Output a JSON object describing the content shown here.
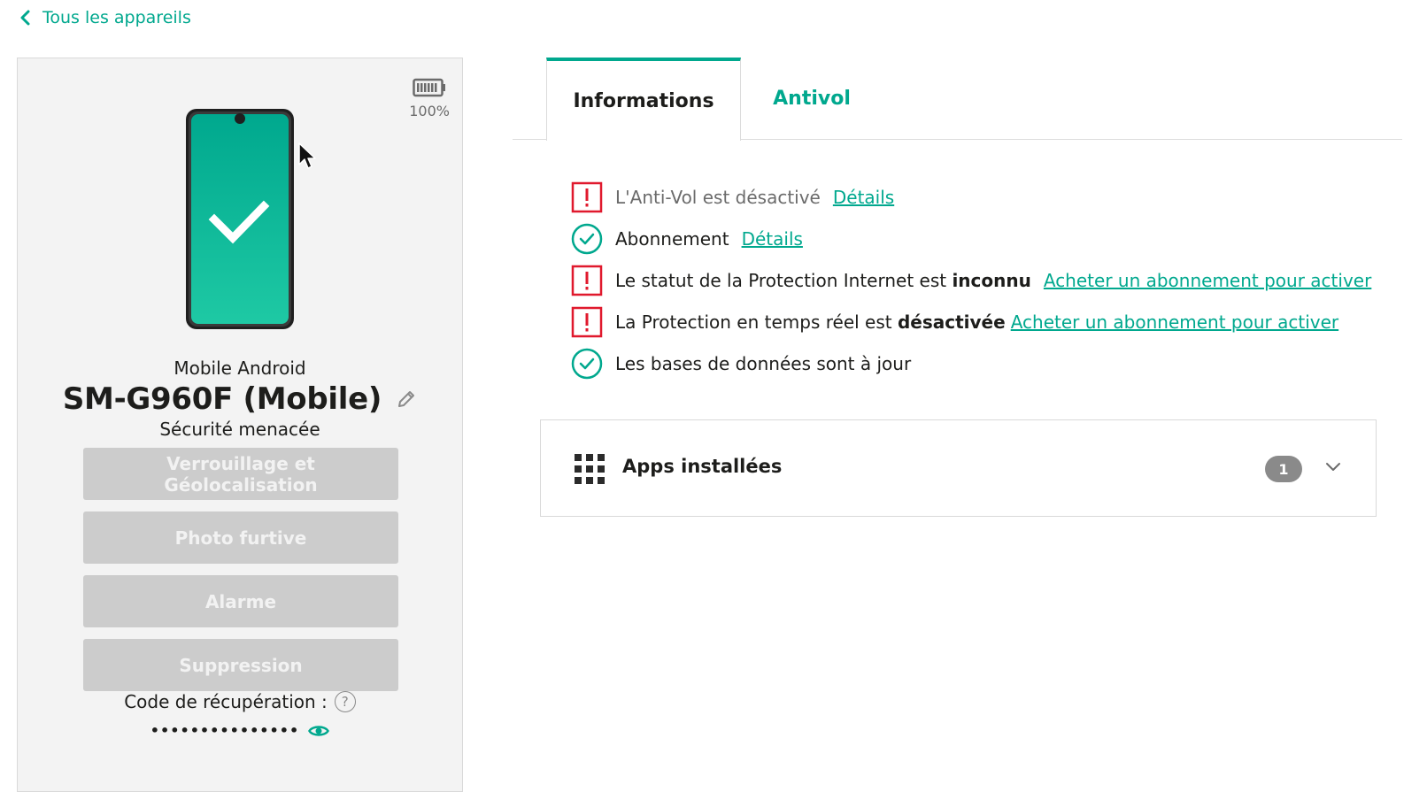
{
  "back_link": {
    "label": "Tous les appareils"
  },
  "device": {
    "battery_level": "100%",
    "type": "Mobile Android",
    "name": "SM-G960F (Mobile)",
    "status": "Sécurité menacée",
    "actions": [
      {
        "label": "Verrouillage et Géolocalisation"
      },
      {
        "label": "Photo furtive"
      },
      {
        "label": "Alarme"
      },
      {
        "label": "Suppression"
      }
    ],
    "recovery_label": "Code de récupération :",
    "recovery_help": "?",
    "recovery_value": "•••••••••••••••",
    "screen_icon": "check-icon"
  },
  "tabs": [
    {
      "label": "Informations",
      "active": true
    },
    {
      "label": "Antivol",
      "active": false
    }
  ],
  "statuses": [
    {
      "icon": "warning-icon",
      "text": "L'Anti-Vol est désactivé",
      "link": "Détails"
    },
    {
      "icon": "ok-icon",
      "text": "Abonnement",
      "link": "Détails"
    },
    {
      "icon": "warning-icon",
      "text": "Le statut de la Protection Internet est",
      "strong": "inconnu",
      "link": "Acheter un abonnement pour activer"
    },
    {
      "icon": "warning-icon",
      "text": "La Protection en temps réel est",
      "strong": "désactivée",
      "link": "Acheter un abonnement pour activer"
    },
    {
      "icon": "ok-icon",
      "text": "Les bases de données sont à jour"
    }
  ],
  "apps": {
    "title": "Apps installées",
    "count": "1"
  },
  "colors": {
    "accent": "#00a88e",
    "warning": "#e0192d",
    "button_disabled": "#cccccc"
  }
}
